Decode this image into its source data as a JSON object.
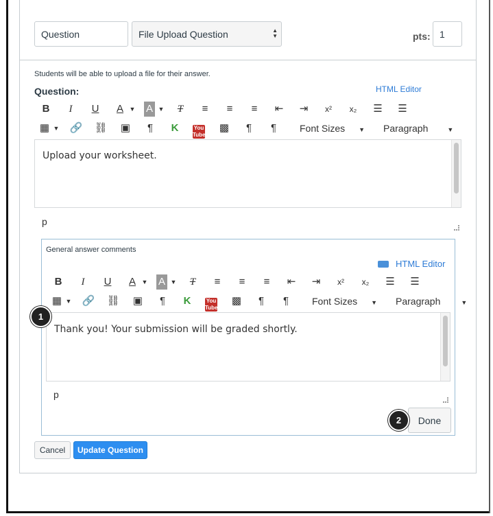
{
  "header": {
    "question_name": "Question",
    "question_type": "File Upload Question",
    "pts_label": "pts:",
    "pts_value": "1"
  },
  "question": {
    "help_text": "Students will be able to upload a file for their answer.",
    "label": "Question:",
    "html_editor_link": "HTML Editor",
    "toolbar": {
      "bold": "B",
      "italic": "I",
      "underline": "U",
      "font_color": "A",
      "bg_color": "A",
      "clear_format": "T",
      "superscript": "x²",
      "subscript": "x₂",
      "bullet_list": "☰",
      "numbered_list": "☰",
      "font_sizes": "Font Sizes",
      "paragraph": "Paragraph"
    },
    "content": "Upload your worksheet.",
    "element_path": "p"
  },
  "comments": {
    "label": "General answer comments",
    "html_editor_link": "HTML Editor",
    "content": "Thank you! Your submission will be graded shortly.",
    "element_path": "p",
    "done_label": "Done"
  },
  "callouts": {
    "one": "1",
    "two": "2"
  },
  "actions": {
    "cancel_label": "Cancel",
    "update_label": "Update Question"
  },
  "colors": {
    "primary": "#2d8ef0",
    "link": "#2d7bd6",
    "border": "#c7cdd1",
    "active_border": "#99bdd6"
  }
}
